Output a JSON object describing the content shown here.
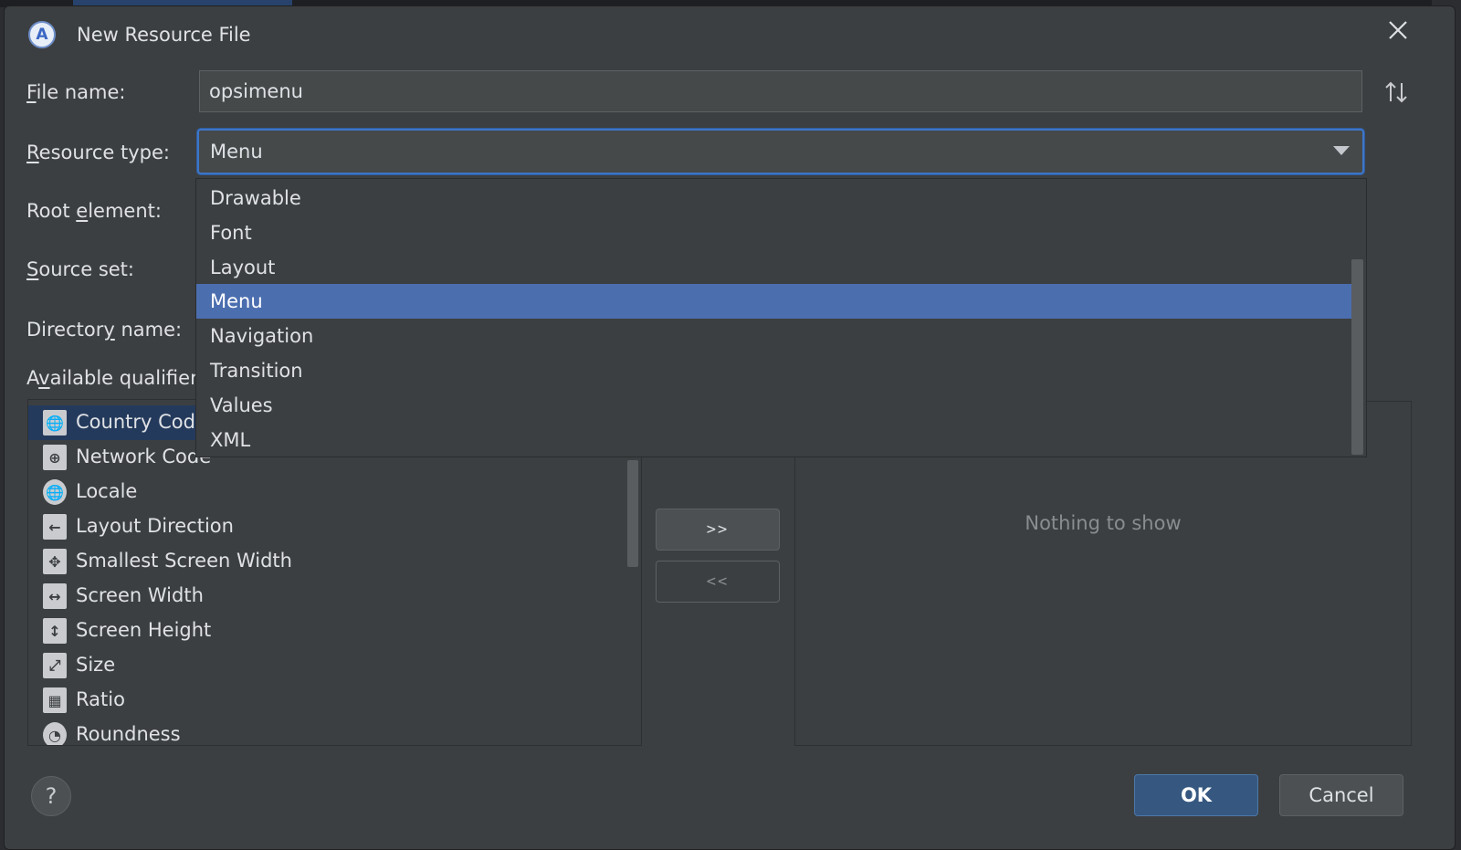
{
  "dialog": {
    "title": "New Resource File"
  },
  "form": {
    "file_name_label_m": "F",
    "file_name_label_rest": "ile name:",
    "file_name_value": "opsimenu",
    "resource_type_label_m": "R",
    "resource_type_label_rest": "esource type:",
    "resource_type_value": "Menu",
    "root_element_label_pre": "Root ",
    "root_element_label_m": "e",
    "root_element_label_rest": "lement:",
    "source_set_label_m": "S",
    "source_set_label_rest": "ource set:",
    "directory_name_label_pre": "Director",
    "directory_name_label_m": "y",
    "directory_name_label_rest": " name:",
    "available_qualifiers_label_pre": "A",
    "available_qualifiers_label_m": "v",
    "available_qualifiers_label_rest": "ailable qualifier"
  },
  "resource_type_options": [
    "Drawable",
    "Font",
    "Layout",
    "Menu",
    "Navigation",
    "Transition",
    "Values",
    "XML"
  ],
  "selected_option": "Menu",
  "qualifiers": [
    {
      "label": "Country Cod",
      "icon": "country-code-icon",
      "glyph": "🌐"
    },
    {
      "label": "Network Code",
      "icon": "network-code-icon",
      "glyph": "⊕"
    },
    {
      "label": "Locale",
      "icon": "locale-icon",
      "glyph": "🌐"
    },
    {
      "label": "Layout Direction",
      "icon": "layout-direction-icon",
      "glyph": "←"
    },
    {
      "label": "Smallest Screen Width",
      "icon": "smallest-screen-width-icon",
      "glyph": "✥"
    },
    {
      "label": "Screen Width",
      "icon": "screen-width-icon",
      "glyph": "↔"
    },
    {
      "label": "Screen Height",
      "icon": "screen-height-icon",
      "glyph": "↕"
    },
    {
      "label": "Size",
      "icon": "size-icon",
      "glyph": "⤢"
    },
    {
      "label": "Ratio",
      "icon": "ratio-icon",
      "glyph": "▦"
    },
    {
      "label": "Roundness",
      "icon": "roundness-icon",
      "glyph": "◔"
    }
  ],
  "buttons": {
    "add": ">>",
    "remove": "<<",
    "ok": "OK",
    "cancel": "Cancel",
    "help": "?"
  },
  "chosen_empty_text": "Nothing to show",
  "colors": {
    "accent": "#4b6eaf",
    "ok_button": "#365880",
    "dialog_bg": "#3c3f41"
  }
}
